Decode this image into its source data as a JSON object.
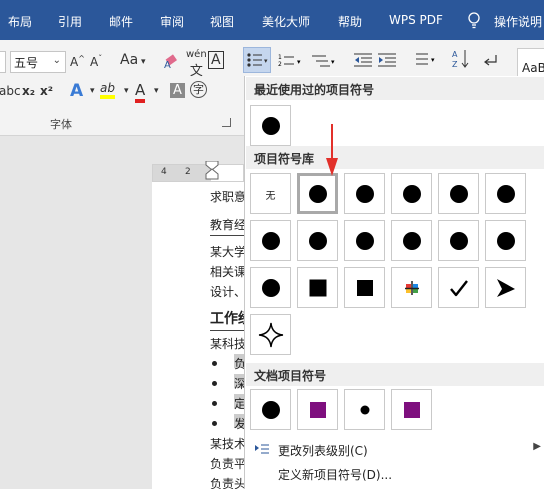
{
  "ribbon_tabs": [
    "布局",
    "引用",
    "邮件",
    "审阅",
    "视图",
    "美化大师",
    "帮助",
    "WPS PDF",
    "操作说明"
  ],
  "font_panel": {
    "font_size_value": "五号",
    "change_case_label": "Aa",
    "phonetic_label": "wén",
    "charborder_label": "A",
    "sub_label": "x₂",
    "sup_label": "x²",
    "strike_partial": "abc",
    "highlight_label": "ab",
    "font_color_label": "A",
    "shade_label": "A",
    "enclose_label": "字",
    "group_label": "字体"
  },
  "paragraph_panel": {
    "style_preview": "AaB"
  },
  "ruler": {
    "ticks": [
      "4",
      "2"
    ]
  },
  "document": {
    "lines": [
      "求职意",
      "教育经",
      "某大学",
      "相关课",
      "设计、",
      "工作经",
      "某科技",
      "负",
      "深",
      "定",
      "发",
      "某技术",
      "负责平",
      "负责头"
    ]
  },
  "bullet_menu": {
    "recent_header": "最近使用过的项目符号",
    "library_header": "项目符号库",
    "none_label": "无",
    "document_header": "文档项目符号",
    "change_level_label": "更改列表级别(C)",
    "define_new_label": "定义新项目符号(D)...",
    "library_symbols": [
      "none",
      "dot",
      "dot",
      "dot",
      "dot",
      "dot",
      "dot",
      "dot",
      "dot",
      "dot",
      "dot",
      "dot",
      "dot",
      "square",
      "diamond",
      "multicolor-cross",
      "checkmark",
      "arrowhead",
      "four-point-star"
    ],
    "document_symbols": [
      "dot",
      "purple-diamond",
      "small-dot",
      "purple-diamond"
    ],
    "selected_index": 1,
    "accent_color": "#e2302a",
    "ribbon_color": "#2b579a"
  }
}
